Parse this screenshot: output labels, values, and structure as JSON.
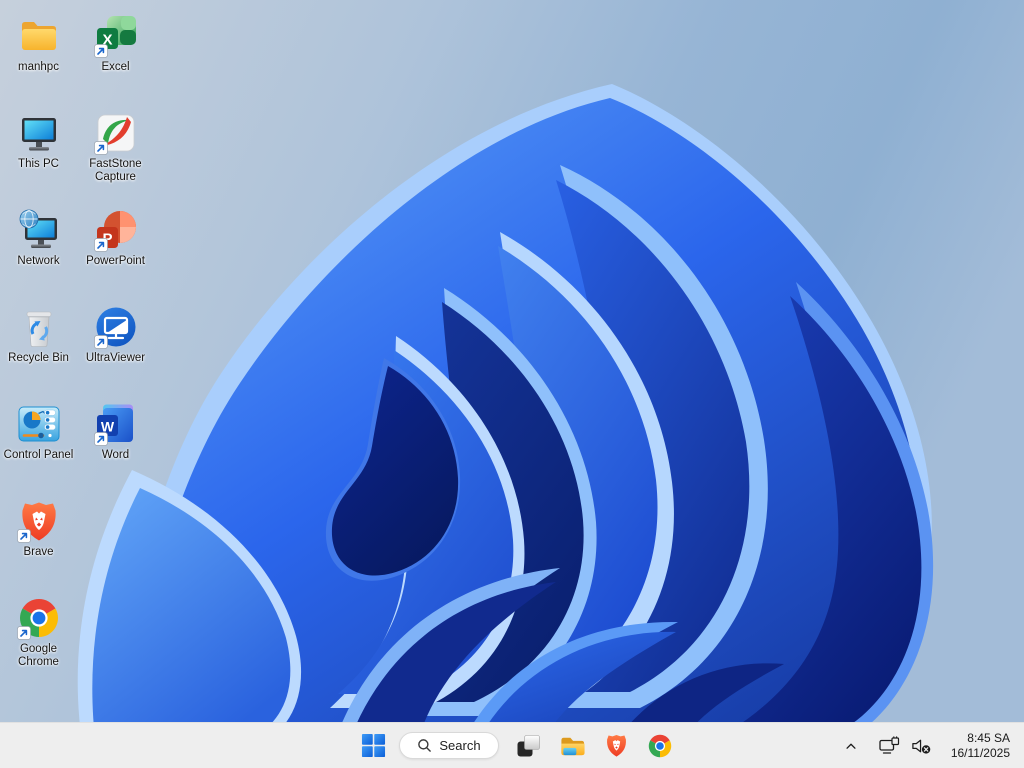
{
  "wallpaper": {
    "name": "windows-11-bloom",
    "accent_blue": "#2a66ec",
    "background_blue": "#9db9d6"
  },
  "desktop": {
    "icons": [
      {
        "label": "manhpc",
        "icon": "folder-icon",
        "shortcut": false
      },
      {
        "label": "This PC",
        "icon": "this-pc-icon",
        "shortcut": false
      },
      {
        "label": "Network",
        "icon": "network-places-icon",
        "shortcut": false
      },
      {
        "label": "Recycle Bin",
        "icon": "recycle-bin-icon",
        "shortcut": false
      },
      {
        "label": "Control Panel",
        "icon": "control-panel-icon",
        "shortcut": false
      },
      {
        "label": "Brave",
        "icon": "brave-icon",
        "shortcut": true
      },
      {
        "label": "Google Chrome",
        "icon": "chrome-icon",
        "shortcut": true
      },
      {
        "label": "Excel",
        "icon": "excel-icon",
        "shortcut": true
      },
      {
        "label": "FastStone Capture",
        "icon": "faststone-capture-icon",
        "shortcut": true
      },
      {
        "label": "PowerPoint",
        "icon": "powerpoint-icon",
        "shortcut": true
      },
      {
        "label": "UltraViewer",
        "icon": "ultraviewer-icon",
        "shortcut": true
      },
      {
        "label": "Word",
        "icon": "word-icon",
        "shortcut": true
      }
    ]
  },
  "taskbar": {
    "search": {
      "label": "Search",
      "icon": "search-icon"
    },
    "buttons": [
      {
        "name": "start",
        "icon": "windows-start-icon"
      },
      {
        "name": "task-view",
        "icon": "task-view-icon"
      },
      {
        "name": "file-explorer",
        "icon": "file-explorer-icon"
      },
      {
        "name": "brave",
        "icon": "brave-icon"
      },
      {
        "name": "chrome",
        "icon": "chrome-icon"
      }
    ],
    "tray": {
      "chevron_icon": "chevron-up-icon",
      "network_icon": "ethernet-network-icon",
      "volume_icon": "volume-muted-icon",
      "time": "8:45 SA",
      "date": "16/11/2025"
    }
  }
}
